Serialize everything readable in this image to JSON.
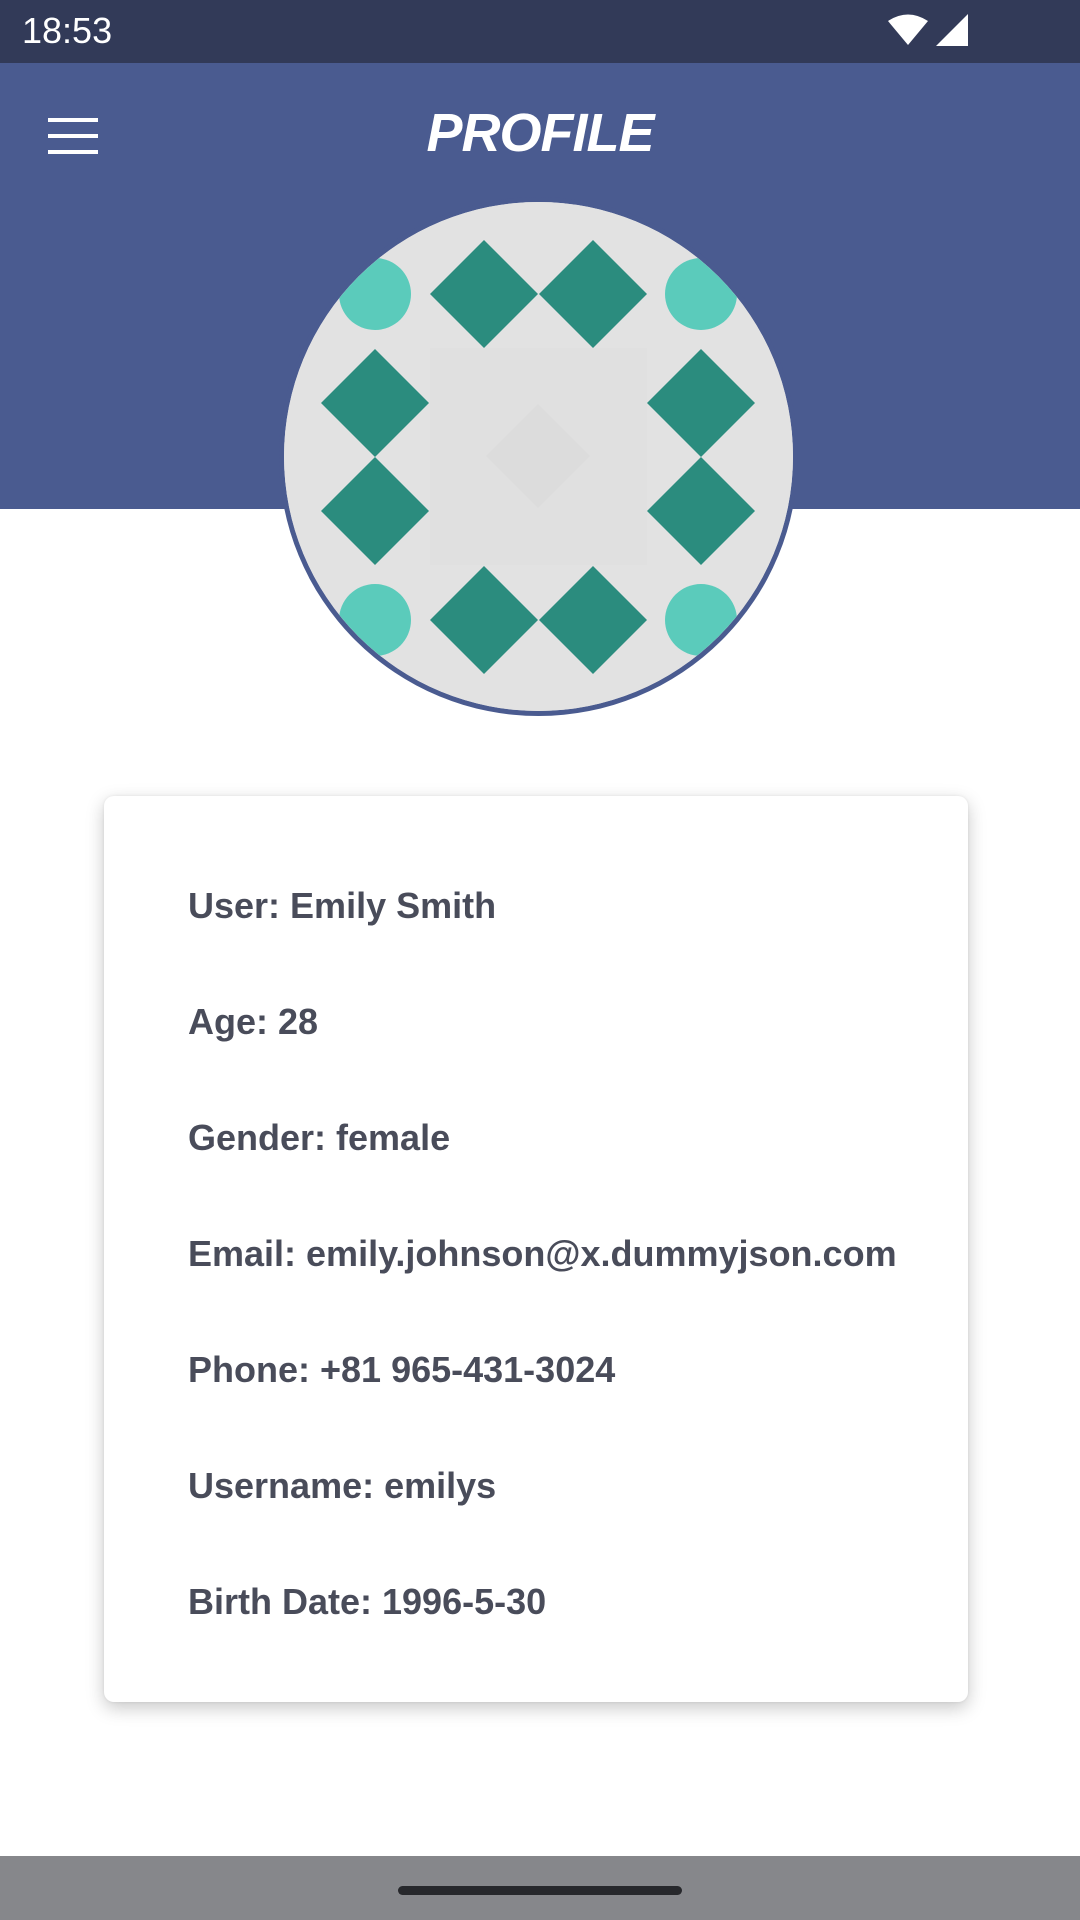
{
  "status_bar": {
    "time": "18:53",
    "icons": [
      "wifi-icon",
      "signal-icon"
    ]
  },
  "header": {
    "title": "PROFILE",
    "menu_icon": "hamburger-menu-icon"
  },
  "avatar": {
    "description_icon": "identicon-avatar"
  },
  "profile": {
    "user": "User: Emily Smith",
    "age": "Age: 28",
    "gender": "Gender: female",
    "email": "Email: emily.johnson@x.dummyjson.com",
    "phone": "Phone: +81 965-431-3024",
    "username": "Username: emilys",
    "birth_date": "Birth Date: 1996-5-30"
  },
  "colors": {
    "header": "#4a5b90",
    "status_bar": "#323a58",
    "avatar_diamond": "#2b8c7e",
    "avatar_dot": "#5bcbbb",
    "text": "#494c5a"
  }
}
